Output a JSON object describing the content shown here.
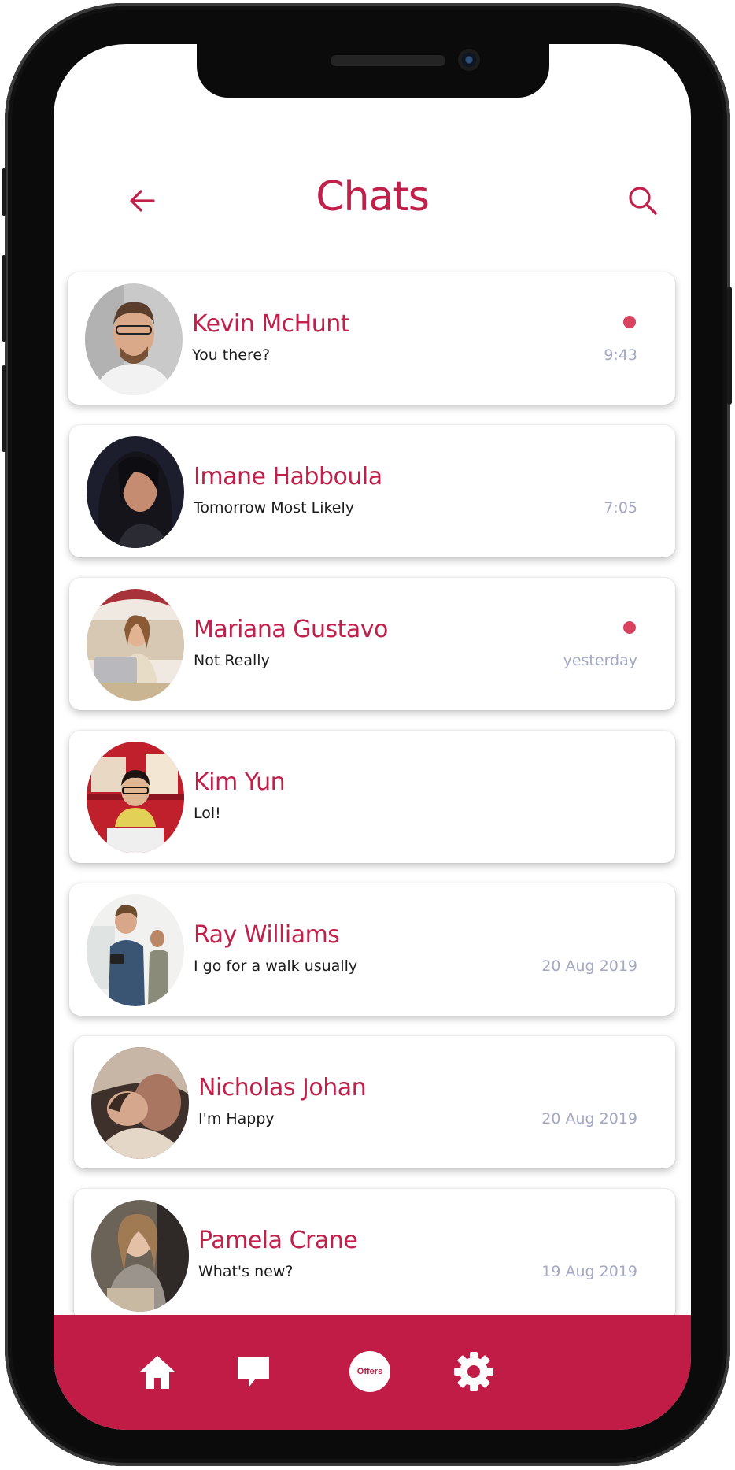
{
  "header": {
    "title": "Chats",
    "back_icon": "arrow-left-icon",
    "search_icon": "search-icon"
  },
  "colors": {
    "accent": "#c0204a",
    "nav_background": "#c01c45",
    "unread_dot": "#d9435f",
    "time_text": "#a3a8c4"
  },
  "chats": [
    {
      "name": "Kevin McHunt",
      "message": "You there?",
      "time": "9:43",
      "unread": true
    },
    {
      "name": "Imane Habboula",
      "message": "Tomorrow Most Likely",
      "time": "7:05",
      "unread": false
    },
    {
      "name": "Mariana Gustavo",
      "message": "Not Really",
      "time": "yesterday",
      "unread": true
    },
    {
      "name": "Kim Yun",
      "message": "Lol!",
      "time": "",
      "unread": false
    },
    {
      "name": "Ray Williams",
      "message": "I go for a walk usually",
      "time": "20 Aug 2019",
      "unread": false
    },
    {
      "name": "Nicholas Johan",
      "message": "I'm Happy",
      "time": "20 Aug 2019",
      "unread": false
    },
    {
      "name": "Pamela Crane",
      "message": "What's new?",
      "time": "19 Aug 2019",
      "unread": false
    }
  ],
  "bottom_nav": {
    "home_icon": "home-icon",
    "chat_icon": "chat-bubble-icon",
    "offers_label": "Offers",
    "settings_icon": "gear-icon"
  }
}
